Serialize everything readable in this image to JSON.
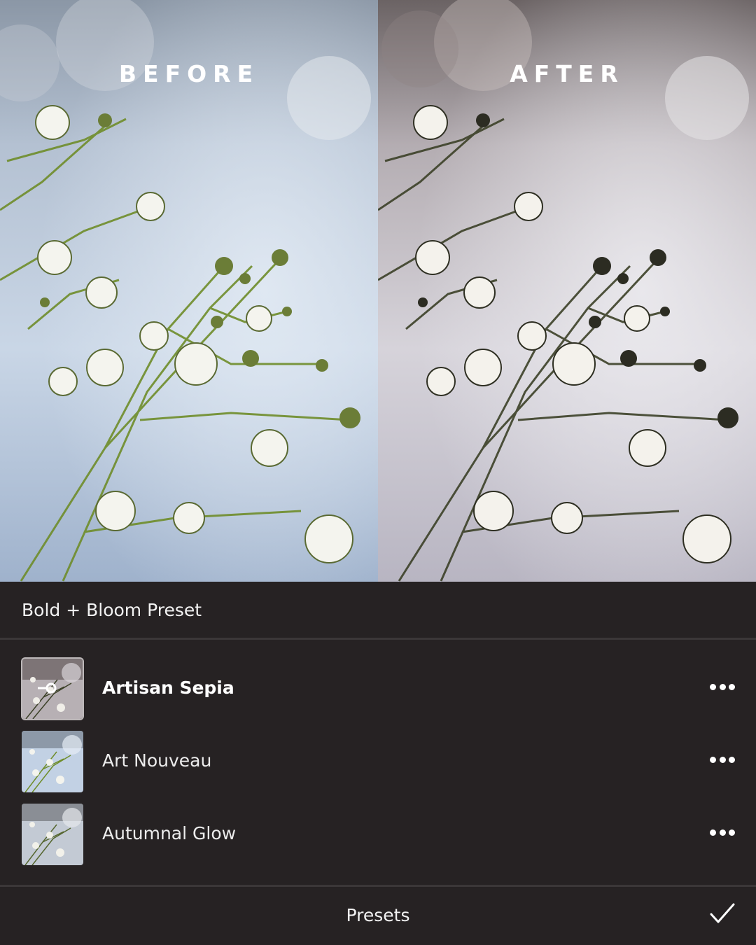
{
  "comparison": {
    "before_label": "BEFORE",
    "after_label": "AFTER"
  },
  "panel": {
    "title": "Bold + Bloom Preset",
    "presets": [
      {
        "name": "Artisan Sepia",
        "selected": true,
        "icon": "slider-icon"
      },
      {
        "name": "Art Nouveau",
        "selected": false
      },
      {
        "name": "Autumnal Glow",
        "selected": false
      }
    ],
    "more_icon": "more-horizontal-icon",
    "footer_label": "Presets",
    "confirm_icon": "checkmark-icon"
  },
  "colors": {
    "panel_bg": "#262223",
    "divider": "#3b3738",
    "before_tone": "#b9cce3",
    "after_tone": "#c7c3c6"
  }
}
